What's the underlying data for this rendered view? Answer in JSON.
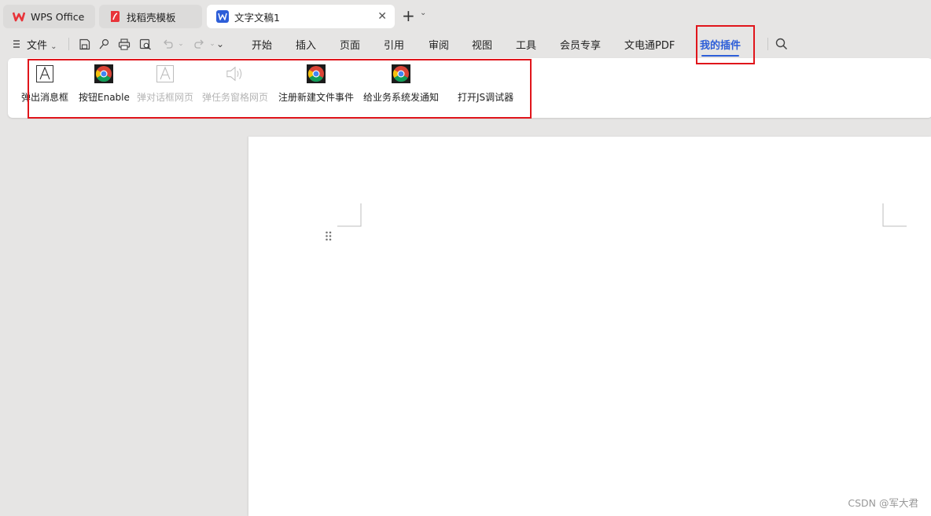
{
  "tabs": [
    {
      "label": "WPS Office"
    },
    {
      "label": "找稻壳模板"
    },
    {
      "label": "文字文稿1"
    }
  ],
  "menu": {
    "file_label": "文件",
    "items": [
      "开始",
      "插入",
      "页面",
      "引用",
      "审阅",
      "视图",
      "工具",
      "会员专享",
      "文电通PDF",
      "我的插件"
    ],
    "active_index": 9
  },
  "ribbon": {
    "buttons": [
      {
        "label": "弹出消息框",
        "icon": "text-box-icon",
        "enabled": true
      },
      {
        "label": "按钮Enable",
        "icon": "chrome-icon",
        "enabled": true
      },
      {
        "label": "弹对话框网页",
        "icon": "text-box-icon",
        "enabled": false
      },
      {
        "label": "弹任务窗格网页",
        "icon": "speaker-icon",
        "enabled": false
      },
      {
        "label": "注册新建文件事件",
        "icon": "chrome-icon",
        "enabled": true
      },
      {
        "label": "给业务系统发通知",
        "icon": "chrome-icon",
        "enabled": true
      },
      {
        "label": "打开JS调试器",
        "icon": "none",
        "enabled": true
      }
    ]
  },
  "watermark": "CSDN @军大君",
  "colors": {
    "accent": "#2d5ed8",
    "highlight_box": "#e0151b",
    "wps_red": "#e8343a"
  }
}
